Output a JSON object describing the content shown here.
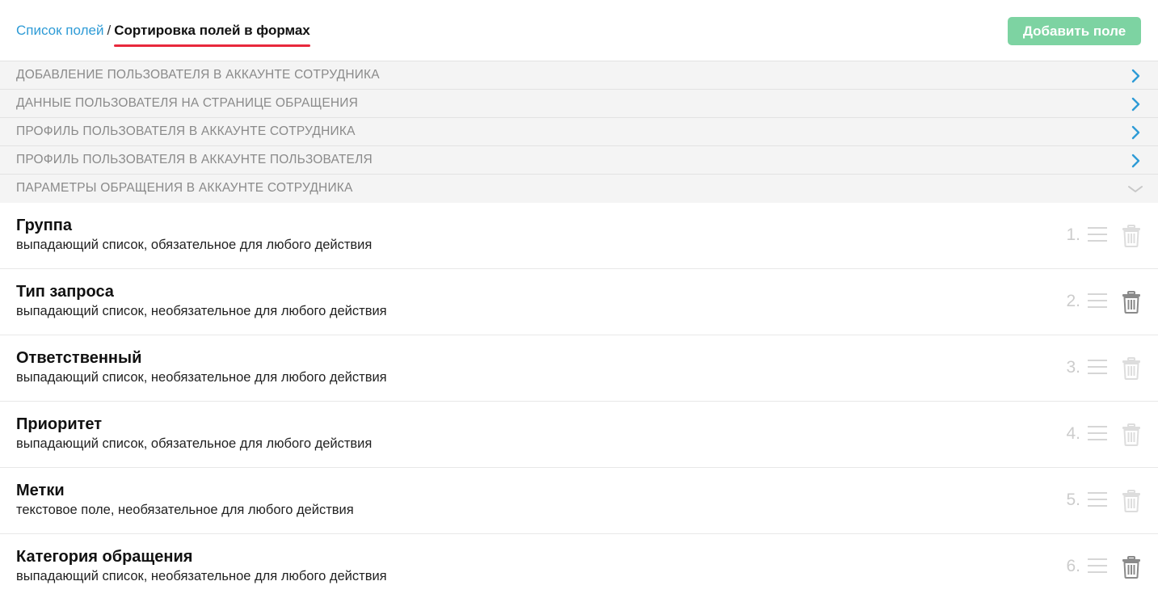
{
  "header": {
    "breadcrumb_link": "Список полей",
    "breadcrumb_separator": "/",
    "breadcrumb_current": "Сортировка полей в формах",
    "add_button_label": "Добавить поле"
  },
  "sections": [
    {
      "label": "ДОБАВЛЕНИЕ ПОЛЬЗОВАТЕЛЯ В АККАУНТЕ СОТРУДНИКА",
      "state": "collapsed"
    },
    {
      "label": "ДАННЫЕ ПОЛЬЗОВАТЕЛЯ НА СТРАНИЦЕ ОБРАЩЕНИЯ",
      "state": "collapsed"
    },
    {
      "label": "ПРОФИЛЬ ПОЛЬЗОВАТЕЛЯ В АККАУНТЕ СОТРУДНИКА",
      "state": "collapsed"
    },
    {
      "label": "ПРОФИЛЬ ПОЛЬЗОВАТЕЛЯ В АККАУНТЕ ПОЛЬЗОВАТЕЛЯ",
      "state": "collapsed"
    },
    {
      "label": "ПАРАМЕТРЫ ОБРАЩЕНИЯ В АККАУНТЕ СОТРУДНИКА",
      "state": "expanded"
    }
  ],
  "fields": [
    {
      "title": "Группа",
      "description": "выпадающий список, обязательное для любого действия",
      "order": "1.",
      "delete_enabled": false
    },
    {
      "title": "Тип запроса",
      "description": "выпадающий список, необязательное для любого действия",
      "order": "2.",
      "delete_enabled": true
    },
    {
      "title": "Ответственный",
      "description": "выпадающий список, необязательное для любого действия",
      "order": "3.",
      "delete_enabled": false
    },
    {
      "title": "Приоритет",
      "description": "выпадающий список, обязательное для любого действия",
      "order": "4.",
      "delete_enabled": false
    },
    {
      "title": "Метки",
      "description": "текстовое поле, необязательное для любого действия",
      "order": "5.",
      "delete_enabled": false
    },
    {
      "title": "Категория обращения",
      "description": "выпадающий список, необязательное для любого действия",
      "order": "6.",
      "delete_enabled": true
    }
  ],
  "icons": {
    "collapsed_chevron": "chevron-right-icon",
    "expanded_chevron": "chevron-down-icon",
    "drag": "drag-handle-icon",
    "delete": "trash-icon"
  },
  "colors": {
    "link": "#2e9bd6",
    "accent_underline": "#e8283c",
    "add_button": "#7dd3a2",
    "chevron_active": "#2e9bd6",
    "chevron_muted": "#c8c8c8",
    "trash_active": "#8a8a8a",
    "trash_disabled": "#dddddd",
    "drag_handle": "#d6d6d6"
  }
}
